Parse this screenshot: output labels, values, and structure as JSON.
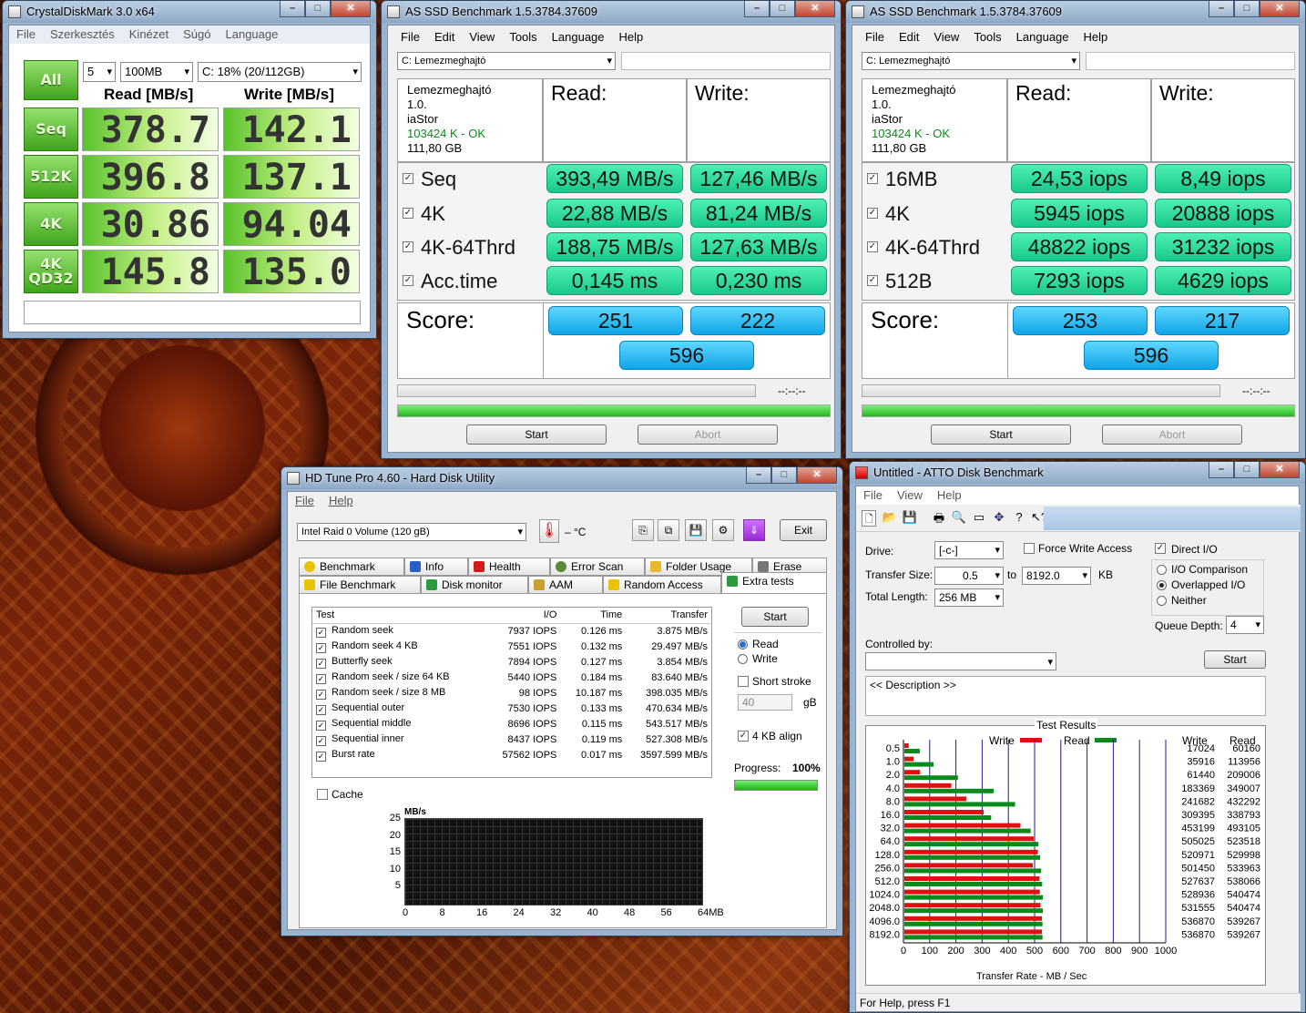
{
  "crystal": {
    "title": "CrystalDiskMark 3.0 x64",
    "menu": [
      "File",
      "Szerkesztés",
      "Kinézet",
      "Súgó",
      "Language"
    ],
    "all_label": "All",
    "runs": "5",
    "size": "100MB",
    "drive": "C: 18% (20/112GB)",
    "read_header": "Read [MB/s]",
    "write_header": "Write [MB/s]",
    "rows": [
      {
        "label": "Seq",
        "read": "378.7",
        "write": "142.1"
      },
      {
        "label": "512K",
        "read": "396.8",
        "write": "137.1"
      },
      {
        "label": "4K",
        "read": "30.86",
        "write": "94.04"
      },
      {
        "label": "4K\nQD32",
        "label1": "4K",
        "label2": "QD32",
        "read": "145.8",
        "write": "135.0"
      }
    ]
  },
  "asssd": [
    {
      "title": "AS SSD Benchmark 1.5.3784.37609",
      "menu": [
        "File",
        "Edit",
        "View",
        "Tools",
        "Language",
        "Help"
      ],
      "drive": "C: Lemezmeghajtó",
      "info": {
        "name": "Lemezmeghajtó",
        "fw": "1.0.",
        "driver": "iaStor",
        "status": "103424 K - OK",
        "size": "111,80 GB"
      },
      "read_header": "Read:",
      "write_header": "Write:",
      "rows": [
        {
          "label": "Seq",
          "read": "393,49 MB/s",
          "write": "127,46 MB/s"
        },
        {
          "label": "4K",
          "read": "22,88 MB/s",
          "write": "81,24 MB/s"
        },
        {
          "label": "4K-64Thrd",
          "read": "188,75 MB/s",
          "write": "127,63 MB/s"
        },
        {
          "label": "Acc.time",
          "read": "0,145 ms",
          "write": "0,230 ms"
        }
      ],
      "score_label": "Score:",
      "score_read": "251",
      "score_write": "222",
      "score_total": "596",
      "time": "--:--:--",
      "start": "Start",
      "abort": "Abort"
    },
    {
      "title": "AS SSD Benchmark 1.5.3784.37609",
      "menu": [
        "File",
        "Edit",
        "View",
        "Tools",
        "Language",
        "Help"
      ],
      "drive": "C: Lemezmeghajtó",
      "info": {
        "name": "Lemezmeghajtó",
        "fw": "1.0.",
        "driver": "iaStor",
        "status": "103424 K - OK",
        "size": "111,80 GB"
      },
      "read_header": "Read:",
      "write_header": "Write:",
      "rows": [
        {
          "label": "16MB",
          "read": "24,53 iops",
          "write": "8,49 iops"
        },
        {
          "label": "4K",
          "read": "5945 iops",
          "write": "20888 iops"
        },
        {
          "label": "4K-64Thrd",
          "read": "48822 iops",
          "write": "31232 iops"
        },
        {
          "label": "512B",
          "read": "7293 iops",
          "write": "4629 iops"
        }
      ],
      "score_label": "Score:",
      "score_read": "253",
      "score_write": "217",
      "score_total": "596",
      "time": "--:--:--",
      "start": "Start",
      "abort": "Abort"
    }
  ],
  "hdtune": {
    "title": "HD Tune Pro 4.60 - Hard Disk Utility",
    "menu": [
      "File",
      "Help"
    ],
    "drive": "Intel   Raid 0 Volume (120 gB)",
    "temp": "– °C",
    "exit": "Exit",
    "tabs_row1": [
      "Benchmark",
      "Info",
      "Health",
      "Error Scan",
      "Folder Usage",
      "Erase"
    ],
    "tabs_row2": [
      "File Benchmark",
      "Disk monitor",
      "AAM",
      "Random Access",
      "Extra tests"
    ],
    "headers": [
      "Test",
      "I/O",
      "Time",
      "Transfer"
    ],
    "rows": [
      [
        "Random seek",
        "7937 IOPS",
        "0.126 ms",
        "3.875 MB/s"
      ],
      [
        "Random seek 4 KB",
        "7551 IOPS",
        "0.132 ms",
        "29.497 MB/s"
      ],
      [
        "Butterfly seek",
        "7894 IOPS",
        "0.127 ms",
        "3.854 MB/s"
      ],
      [
        "Random seek / size 64 KB",
        "5440 IOPS",
        "0.184 ms",
        "83.640 MB/s"
      ],
      [
        "Random seek / size 8 MB",
        "98 IOPS",
        "10.187 ms",
        "398.035 MB/s"
      ],
      [
        "Sequential outer",
        "7530 IOPS",
        "0.133 ms",
        "470.634 MB/s"
      ],
      [
        "Sequential middle",
        "8696 IOPS",
        "0.115 ms",
        "543.517 MB/s"
      ],
      [
        "Sequential inner",
        "8437 IOPS",
        "0.119 ms",
        "527.308 MB/s"
      ],
      [
        "Burst rate",
        "57562 IOPS",
        "0.017 ms",
        "3597.599 MB/s"
      ]
    ],
    "cache": "Cache",
    "start": "Start",
    "read": "Read",
    "write": "Write",
    "short_stroke": "Short stroke",
    "stroke_val": "40",
    "gb": "gB",
    "align": "4 KB align",
    "progress_label": "Progress:",
    "progress": "100%",
    "progress_value": 1.0,
    "chart_unit": "MB/s",
    "y_ticks": [
      "25",
      "20",
      "15",
      "10",
      "5"
    ],
    "x_ticks": [
      "0",
      "8",
      "16",
      "24",
      "32",
      "40",
      "48",
      "56",
      "64MB"
    ]
  },
  "atto": {
    "title": "Untitled - ATTO Disk Benchmark",
    "menu": [
      "File",
      "View",
      "Help"
    ],
    "drive_label": "Drive:",
    "drive": "[-c-]",
    "force_write": "Force Write Access",
    "direct_io": "Direct I/O",
    "transfer_label": "Transfer Size:",
    "ts_from": "0.5",
    "to": "to",
    "ts_to": "8192.0",
    "kb": "KB",
    "length_label": "Total Length:",
    "length": "256 MB",
    "io_comp": "I/O Comparison",
    "overlapped": "Overlapped I/O",
    "neither": "Neither",
    "queue_label": "Queue Depth:",
    "queue": "4",
    "controlled": "Controlled by:",
    "start": "Start",
    "description": "<< Description >>",
    "results_title": "Test Results",
    "legend_write": "Write",
    "legend_read": "Read",
    "col_write": "Write",
    "col_read": "Read",
    "axis_label": "Transfer Rate - MB / Sec",
    "status": "For Help, press F1",
    "colors": {
      "write": "#e01010",
      "read": "#0a8a1a"
    }
  },
  "chart_data": {
    "type": "bar",
    "title": "Test Results",
    "xlabel": "Transfer Rate - MB / Sec",
    "xlim": [
      0,
      1000
    ],
    "x_ticks": [
      "0",
      "100",
      "200",
      "300",
      "400",
      "500",
      "600",
      "700",
      "800",
      "900",
      "1000"
    ],
    "categories": [
      "0.5",
      "1.0",
      "2.0",
      "4.0",
      "8.0",
      "16.0",
      "32.0",
      "64.0",
      "128.0",
      "256.0",
      "512.0",
      "1024.0",
      "2048.0",
      "4096.0",
      "8192.0"
    ],
    "series": [
      {
        "name": "Write",
        "values": [
          17024,
          35916,
          61440,
          183369,
          241682,
          309395,
          453199,
          505025,
          520971,
          501450,
          527637,
          528936,
          531555,
          536870,
          536870
        ]
      },
      {
        "name": "Read",
        "values": [
          60160,
          113956,
          209006,
          349007,
          432292,
          338793,
          493105,
          523518,
          529998,
          533963,
          538066,
          540474,
          540474,
          539267,
          539267
        ]
      }
    ],
    "write_labels": [
      "17024",
      "35916",
      "61440",
      "183369",
      "241682",
      "309395",
      "453199",
      "505025",
      "520971",
      "501450",
      "527637",
      "528936",
      "531555",
      "536870",
      "536870"
    ],
    "read_labels": [
      "60160",
      "113956",
      "209006",
      "349007",
      "432292",
      "338793",
      "493105",
      "523518",
      "529998",
      "533963",
      "538066",
      "540474",
      "540474",
      "539267",
      "539267"
    ]
  }
}
